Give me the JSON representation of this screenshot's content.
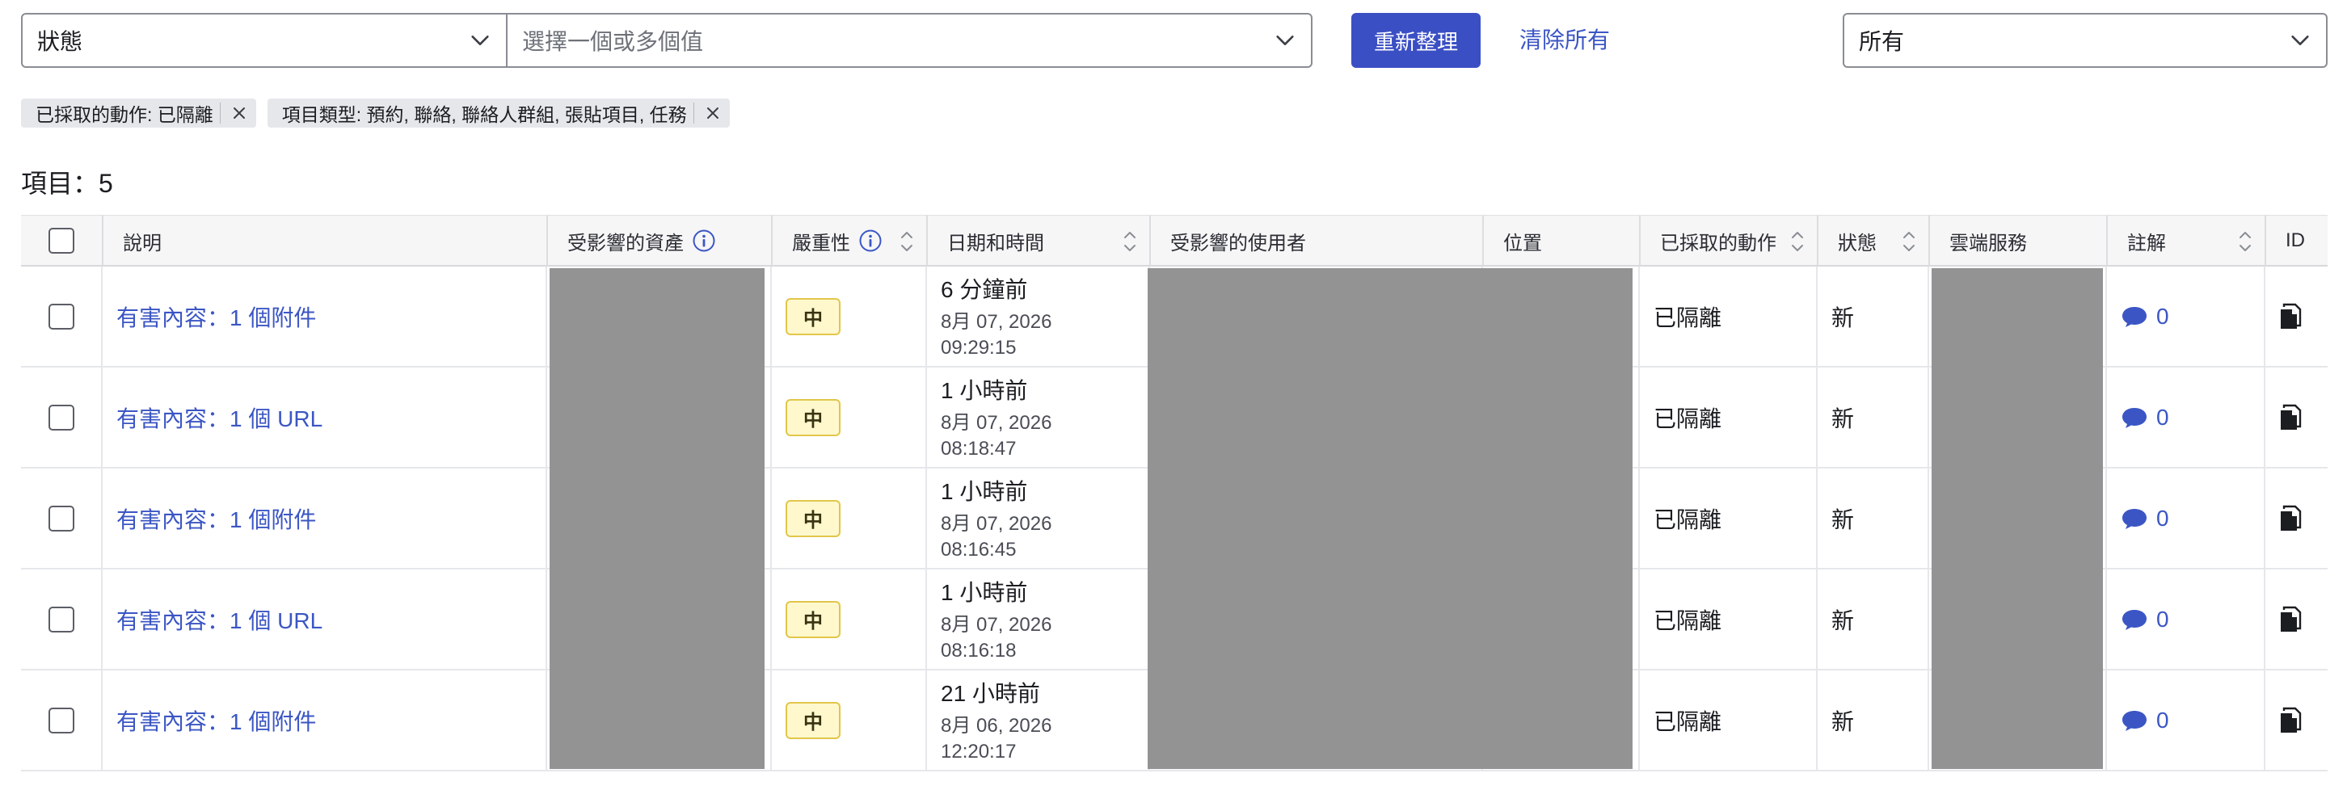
{
  "filters": {
    "field_value": "狀態",
    "values_placeholder": "選擇一個或多個值",
    "refresh_label": "重新整理",
    "clear_all_label": "清除所有",
    "scope_value": "所有"
  },
  "chips": [
    {
      "label": "已採取的動作: 已隔離"
    },
    {
      "label": "項目類型: 預約, 聯絡, 聯絡人群組, 張貼項目, 任務"
    }
  ],
  "item_count": "項目：5",
  "table": {
    "headers": {
      "description": "說明",
      "affected_assets": "受影響的資產",
      "severity": "嚴重性",
      "datetime": "日期和時間",
      "affected_users": "受影響的使用者",
      "location": "位置",
      "action_taken": "已採取的動作",
      "status": "狀態",
      "cloud_service": "雲端服務",
      "notes": "註解",
      "id": "ID"
    },
    "rows": [
      {
        "description": "有害內容：1 個附件",
        "severity": "中",
        "relative": "6 分鐘前",
        "date": "8月 07, 2026",
        "time": "09:29:15",
        "action": "已隔離",
        "status": "新",
        "notes": "0"
      },
      {
        "description": "有害內容：1 個 URL",
        "severity": "中",
        "relative": "1 小時前",
        "date": "8月 07, 2026",
        "time": "08:18:47",
        "action": "已隔離",
        "status": "新",
        "notes": "0"
      },
      {
        "description": "有害內容：1 個附件",
        "severity": "中",
        "relative": "1 小時前",
        "date": "8月 07, 2026",
        "time": "08:16:45",
        "action": "已隔離",
        "status": "新",
        "notes": "0"
      },
      {
        "description": "有害內容：1 個 URL",
        "severity": "中",
        "relative": "1 小時前",
        "date": "8月 07, 2026",
        "time": "08:16:18",
        "action": "已隔離",
        "status": "新",
        "notes": "0"
      },
      {
        "description": "有害內容：1 個附件",
        "severity": "中",
        "relative": "21 小時前",
        "date": "8月 06, 2026",
        "time": "12:20:17",
        "action": "已隔離",
        "status": "新",
        "notes": "0"
      }
    ]
  },
  "colors": {
    "primary": "#3b4fc4",
    "link": "#3b56c4",
    "severity_medium_bg": "#fff8cc",
    "redacted": "#939393"
  }
}
